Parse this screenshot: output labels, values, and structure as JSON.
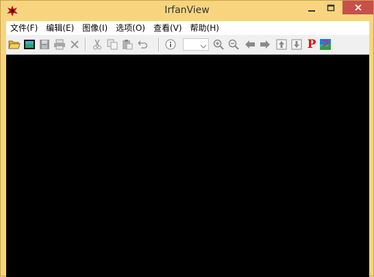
{
  "window": {
    "title": "IrfanView",
    "accent_color": "#f7d57f",
    "close_color": "#c7504a"
  },
  "menu": {
    "items": [
      {
        "label": "文件(F)",
        "name": "menu-file"
      },
      {
        "label": "编辑(E)",
        "name": "menu-edit"
      },
      {
        "label": "图像(I)",
        "name": "menu-image"
      },
      {
        "label": "选项(O)",
        "name": "menu-options"
      },
      {
        "label": "查看(V)",
        "name": "menu-view"
      },
      {
        "label": "帮助(H)",
        "name": "menu-help"
      }
    ]
  },
  "toolbar": {
    "icons": [
      "open-folder-icon",
      "slideshow-icon",
      "save-icon",
      "print-icon",
      "delete-icon",
      "cut-icon",
      "copy-icon",
      "paste-icon",
      "undo-icon",
      "info-icon",
      "zoom-in-icon",
      "zoom-out-icon",
      "previous-icon",
      "next-icon",
      "first-icon",
      "last-icon",
      "paint-icon",
      "thumbnails-icon"
    ],
    "paint_label": "P",
    "zoom_value": ""
  }
}
